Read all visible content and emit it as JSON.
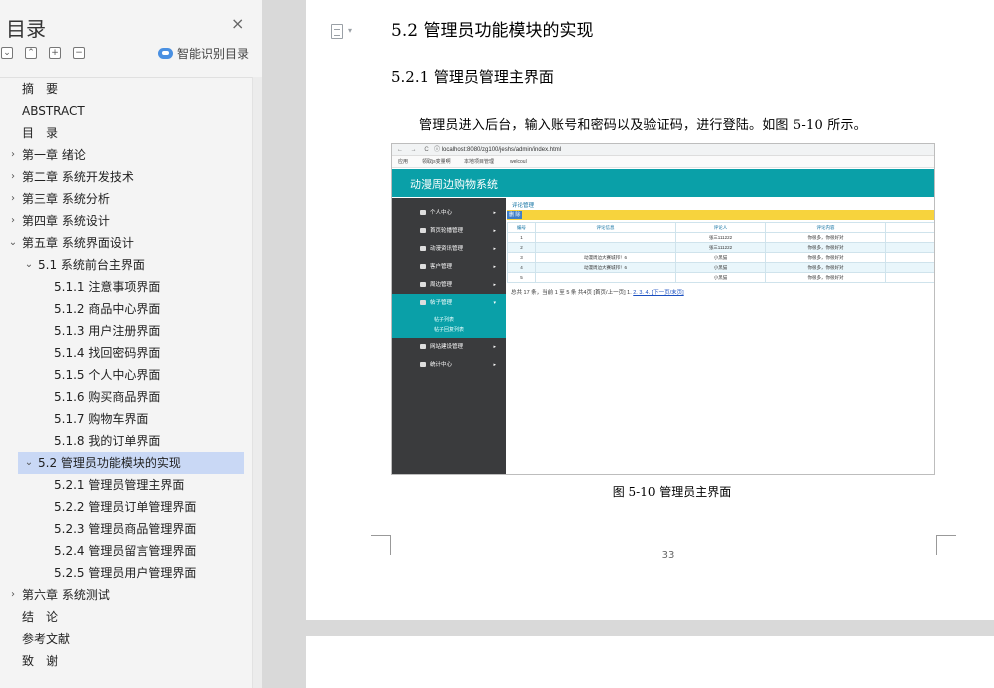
{
  "toc": {
    "title": "目录",
    "close_glyph": "×",
    "ai_label": "智能识别目录",
    "items": [
      {
        "label": "摘　要",
        "level": 0,
        "toggle": ""
      },
      {
        "label": "ABSTRACT",
        "level": 0,
        "toggle": ""
      },
      {
        "label": "目　录",
        "level": 0,
        "toggle": ""
      },
      {
        "label": "第一章  绪论",
        "level": 0,
        "toggle": "›"
      },
      {
        "label": "第二章  系统开发技术",
        "level": 0,
        "toggle": "›"
      },
      {
        "label": "第三章  系统分析",
        "level": 0,
        "toggle": "›"
      },
      {
        "label": "第四章  系统设计",
        "level": 0,
        "toggle": "›"
      },
      {
        "label": "第五章  系统界面设计",
        "level": 0,
        "toggle": "⌄"
      },
      {
        "label": "5.1  系统前台主界面",
        "level": 1,
        "toggle": "⌄"
      },
      {
        "label": "5.1.1  注意事项界面",
        "level": 2,
        "toggle": ""
      },
      {
        "label": "5.1.2  商品中心界面",
        "level": 2,
        "toggle": ""
      },
      {
        "label": "5.1.3  用户注册界面",
        "level": 2,
        "toggle": ""
      },
      {
        "label": "5.1.4  找回密码界面",
        "level": 2,
        "toggle": ""
      },
      {
        "label": "5.1.5  个人中心界面",
        "level": 2,
        "toggle": ""
      },
      {
        "label": "5.1.6  购买商品界面",
        "level": 2,
        "toggle": ""
      },
      {
        "label": "5.1.7  购物车界面",
        "level": 2,
        "toggle": ""
      },
      {
        "label": "5.1.8  我的订单界面",
        "level": 2,
        "toggle": ""
      },
      {
        "label": "5.2 管理员功能模块的实现",
        "level": 1,
        "toggle": "⌄",
        "active": true
      },
      {
        "label": "5.2.1  管理员管理主界面",
        "level": 2,
        "toggle": ""
      },
      {
        "label": "5.2.2  管理员订单管理界面",
        "level": 2,
        "toggle": ""
      },
      {
        "label": "5.2.3  管理员商品管理界面",
        "level": 2,
        "toggle": ""
      },
      {
        "label": "5.2.4  管理员留言管理界面",
        "level": 2,
        "toggle": ""
      },
      {
        "label": "5.2.5  管理员用户管理界面",
        "level": 2,
        "toggle": ""
      },
      {
        "label": "第六章  系统测试",
        "level": 0,
        "toggle": "›"
      },
      {
        "label": "结　论",
        "level": 0,
        "toggle": ""
      },
      {
        "label": "参考文献",
        "level": 0,
        "toggle": ""
      },
      {
        "label": "致　谢",
        "level": 0,
        "toggle": ""
      }
    ]
  },
  "doc": {
    "heading": "5.2 管理员功能模块的实现",
    "subheading": "5.2.1  管理员管理主界面",
    "paragraph": "管理员进入后台，输入账号和密码以及验证码，进行登陆。如图 5-10 所示。",
    "caption": "图 5-10    管理员主界面",
    "page_number": "33"
  },
  "figure": {
    "browser_nav": "← → C",
    "url": "ⓘ  localhost:8080/zg100/jeshs/admin/index.html",
    "bookmarks": [
      "应用",
      "领取js变量啊",
      "本地项目管理",
      "welcoul"
    ],
    "app_title": "动漫周边购物系统",
    "menu": [
      {
        "label": "个人中心",
        "arrow": "▸"
      },
      {
        "label": "首页轮播管理",
        "arrow": "▸"
      },
      {
        "label": "动漫资讯管理",
        "arrow": "▸"
      },
      {
        "label": "客户管理",
        "arrow": "▸"
      },
      {
        "label": "周边管理",
        "arrow": "▸"
      },
      {
        "label": "帖子管理",
        "arrow": "▾",
        "active": true
      },
      {
        "label": "网站建设管理",
        "arrow": "▸"
      },
      {
        "label": "统计中心",
        "arrow": "▸"
      }
    ],
    "submenu": [
      "帖子列表",
      "帖子回复列表"
    ],
    "crumb": "评论管理",
    "toolbar_tag": "删 除",
    "table_headers": [
      "编号",
      "评论信息",
      "评论人",
      "评论内容"
    ],
    "table_rows": [
      [
        "1",
        "",
        "张三111222",
        "你很多，你很好对"
      ],
      [
        "2",
        "",
        "张三111222",
        "你很多，你很好对"
      ],
      [
        "3",
        "动漫周边大赛城邦！6",
        "小黑猫",
        "你很多，你很好对"
      ],
      [
        "4",
        "动漫周边大赛城邦！6",
        "小黑猫",
        "你很多，你很好对"
      ],
      [
        "5",
        "",
        "小黑猫",
        "你很多，你很好对"
      ]
    ],
    "pager_text": "总共 17 条，当前 1 至 5 条 共4页 [首页/上一页] 1. ",
    "pager_links": "2. 3. 4. [下一页/末页]"
  }
}
